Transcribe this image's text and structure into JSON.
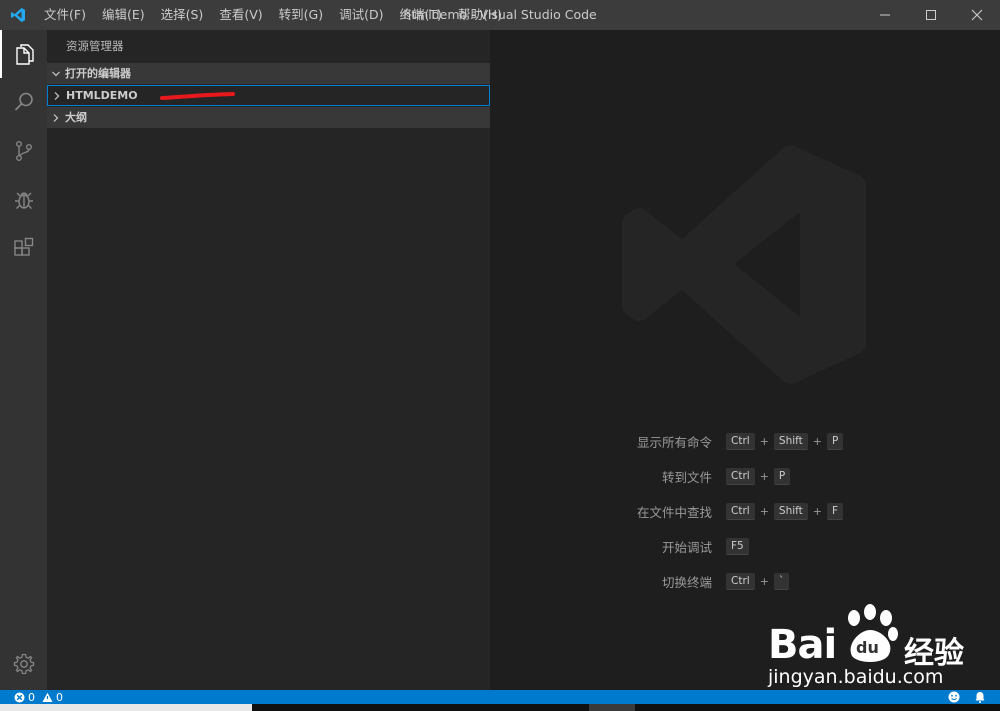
{
  "titlebar": {
    "menu": [
      "文件(F)",
      "编辑(E)",
      "选择(S)",
      "查看(V)",
      "转到(G)",
      "调试(D)",
      "终端(T)",
      "帮助(H)"
    ],
    "title": "htmldemo - Visual Studio Code"
  },
  "activity_bar": {
    "items": [
      "files-icon",
      "search-icon",
      "source-control-icon",
      "debug-icon",
      "extensions-icon"
    ],
    "bottom": "gear-icon"
  },
  "sidebar": {
    "title": "资源管理器",
    "sections": {
      "open_editors": "打开的编辑器",
      "folder": "HTMLDEMO",
      "outline": "大纲"
    }
  },
  "editor": {
    "shortcuts": [
      {
        "label": "显示所有命令",
        "keys": [
          "Ctrl",
          "Shift",
          "P"
        ]
      },
      {
        "label": "转到文件",
        "keys": [
          "Ctrl",
          "P"
        ]
      },
      {
        "label": "在文件中查找",
        "keys": [
          "Ctrl",
          "Shift",
          "F"
        ]
      },
      {
        "label": "开始调试",
        "keys": [
          "F5"
        ]
      },
      {
        "label": "切换终端",
        "keys": [
          "Ctrl",
          "`"
        ]
      }
    ]
  },
  "statusbar": {
    "errors": "0",
    "warnings": "0"
  },
  "watermark": {
    "brand_left": "Bai",
    "brand_right": "经验",
    "url": "jingyan.baidu.com",
    "paw_text": "du"
  },
  "colors": {
    "accent": "#007acc",
    "annotation": "#e8191c"
  }
}
